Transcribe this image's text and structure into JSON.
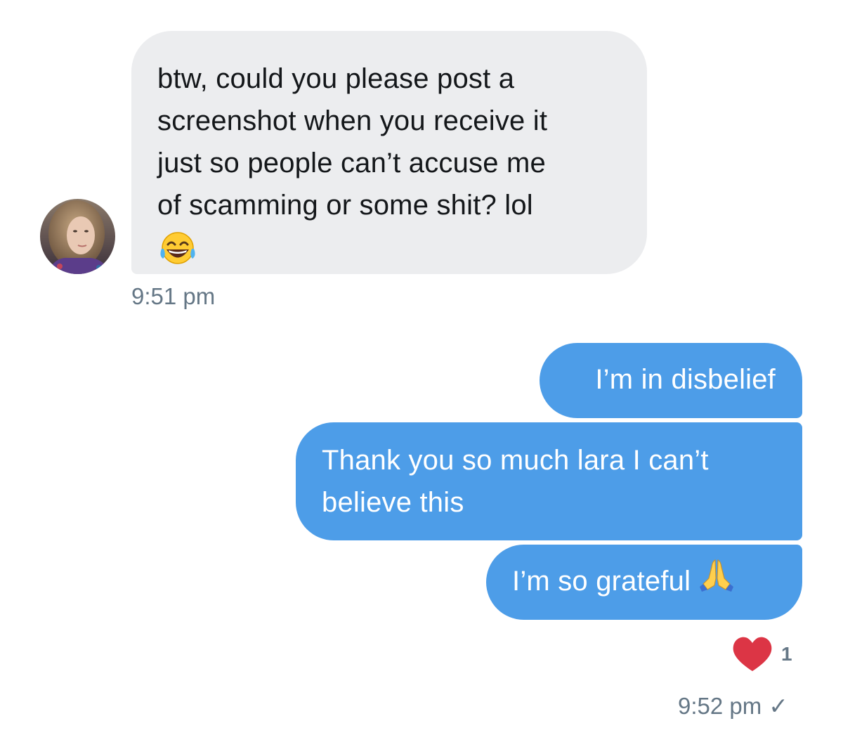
{
  "incoming": {
    "lines": [
      "btw, could you please post a",
      "screenshot when you receive it",
      "just so people can’t accuse me",
      "of scamming or some shit? lol"
    ],
    "emoji": "face-with-tears-of-joy-icon",
    "timestamp": "9:51 pm",
    "bubble_color": "#ecedef"
  },
  "outgoing": {
    "bubble_color": "#4d9de8",
    "messages": [
      {
        "text": "I’m in disbelief"
      },
      {
        "lines": [
          "Thank you so much lara I can’t",
          "believe this"
        ]
      },
      {
        "text": "I’m so grateful",
        "emoji": "folded-hands-icon"
      }
    ],
    "reaction": {
      "icon": "heart-icon",
      "count": "1",
      "color": "#e0245e"
    },
    "timestamp": "9:52 pm",
    "status_mark": "✓"
  }
}
